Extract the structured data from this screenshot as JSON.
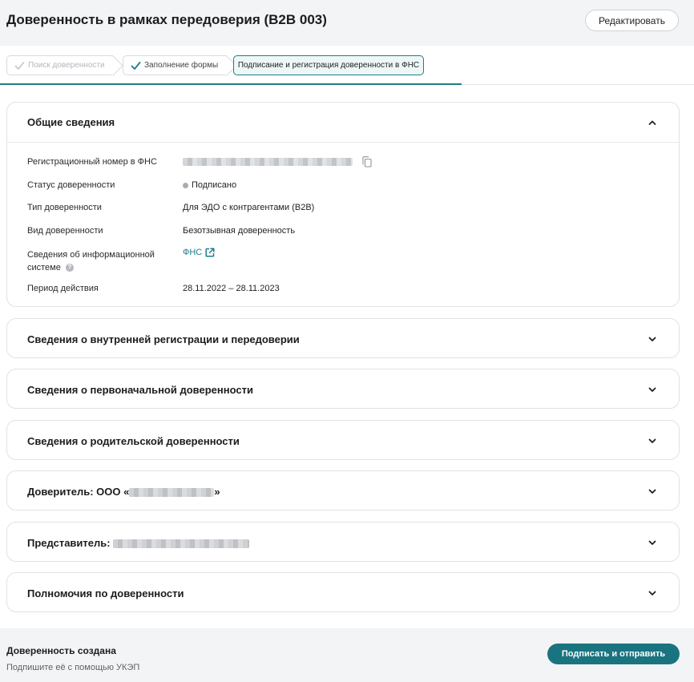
{
  "header": {
    "title": "Доверенность в рамках передоверия (B2B 003)",
    "edit_label": "Редактировать"
  },
  "steps": [
    {
      "label": "Поиск доверенности",
      "state": "done-disabled"
    },
    {
      "label": "Заполнение формы",
      "state": "done"
    },
    {
      "label": "Подписание и регистрация доверенности в ФНС",
      "state": "active"
    }
  ],
  "general": {
    "title": "Общие сведения",
    "rows": {
      "reg_number": {
        "label": "Регистрационный номер в ФНС"
      },
      "status": {
        "label": "Статус доверенности",
        "value": "Подписано"
      },
      "type": {
        "label": "Тип доверенности",
        "value": "Для ЭДО с контрагентами (B2B)"
      },
      "kind": {
        "label": "Вид доверенности",
        "value": "Безотзывная доверенность"
      },
      "info_system": {
        "label_line1": "Сведения об информационной",
        "label_line2": "системе",
        "help": "?",
        "value": "ФНС"
      },
      "period": {
        "label": "Период действия",
        "value": "28.11.2022 – 28.11.2023"
      }
    }
  },
  "sections": {
    "internal": "Сведения о внутренней регистрации и передоверии",
    "original": "Сведения о первоначальной доверенности",
    "parent": "Сведения о родительской доверенности",
    "principal_prefix": "Доверитель: ООО «",
    "principal_suffix": "»",
    "representative": "Представитель:",
    "powers": "Полномочия по доверенности"
  },
  "footer": {
    "title": "Доверенность создана",
    "subtitle": "Подпишите её с помощью УКЭП",
    "sign_label": "Подписать и отправить"
  },
  "colors": {
    "accent": "#1d7e8a",
    "button": "#1a7480",
    "status_dot": "#a9adb2"
  },
  "icons": [
    "check-icon",
    "chevron-up-icon",
    "chevron-down-icon",
    "copy-icon",
    "external-link-icon",
    "help-icon"
  ]
}
